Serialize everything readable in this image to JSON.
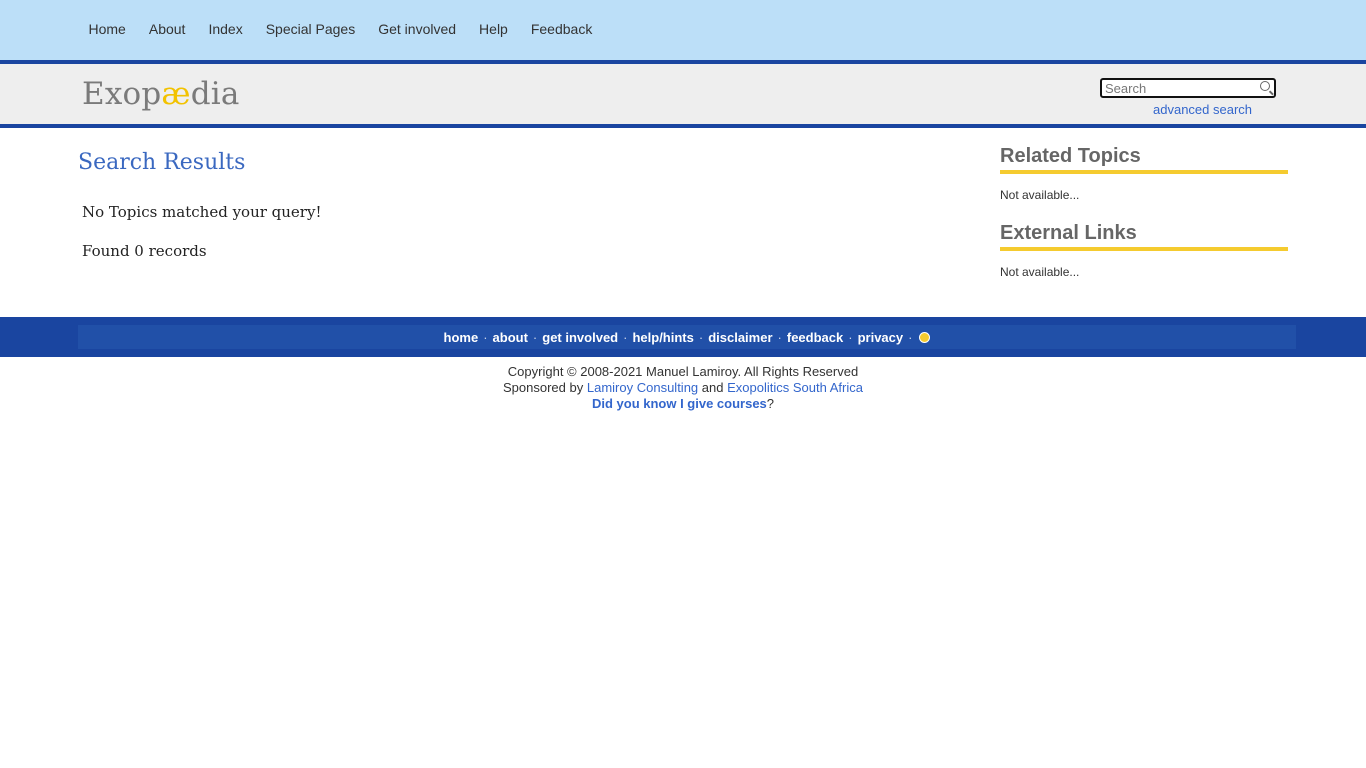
{
  "nav": {
    "items": [
      "Home",
      "About",
      "Index",
      "Special Pages",
      "Get involved",
      "Help",
      "Feedback"
    ]
  },
  "brand": {
    "logo_part1": "Exop",
    "logo_ae": "æ",
    "logo_part2": "dia",
    "search_placeholder": "Search",
    "advanced_search": "advanced search"
  },
  "main": {
    "title": "Search Results",
    "no_match": "No Topics matched your query!",
    "found": "Found 0 records"
  },
  "sidebar": {
    "related_title": "Related Topics",
    "related_text": "Not available...",
    "external_title": "External Links",
    "external_text": "Not available..."
  },
  "footer": {
    "links": [
      "home",
      "about",
      "get involved",
      "help/hints",
      "disclaimer",
      "feedback",
      "privacy"
    ],
    "separator": "·",
    "copyright": "Copyright © 2008-2021 Manuel Lamiroy. All Rights Reserved",
    "sponsored_prefix": "Sponsored by",
    "sponsor1": "Lamiroy Consulting",
    "and": "and",
    "sponsor2": "Exopolitics South Africa",
    "courses": "Did you know I give courses",
    "question_mark": "?"
  },
  "colors": {
    "nav_bg": "#bcdff8",
    "brand_blue": "#1a45a0",
    "accent_yellow": "#f5cb2f",
    "link_blue": "#3366cc"
  }
}
